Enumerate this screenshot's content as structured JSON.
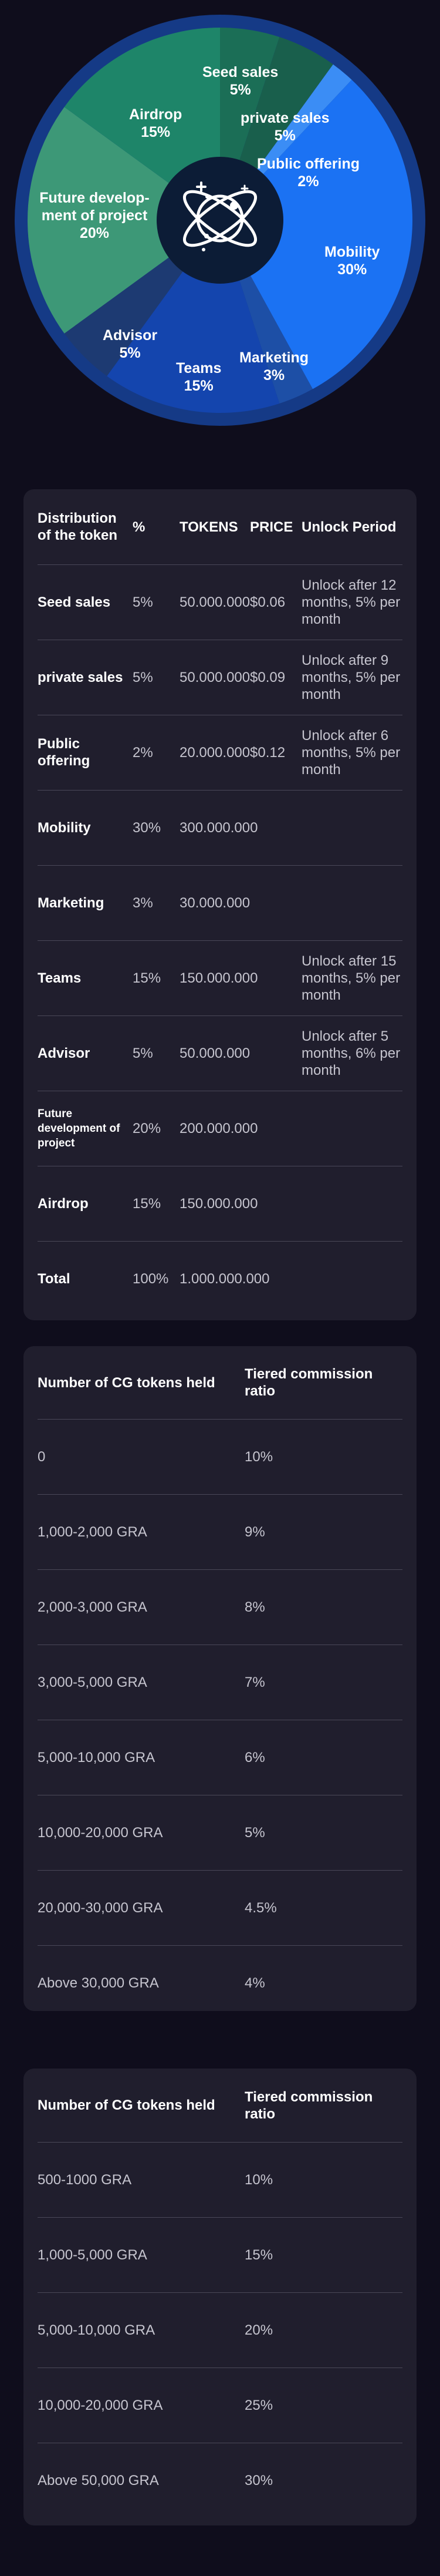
{
  "pie": {
    "slices": [
      {
        "name": "Seed sales",
        "pct": "5%",
        "value": 5,
        "color": "#1b6e56"
      },
      {
        "name": "private sales",
        "pct": "5%",
        "value": 5,
        "color": "#195f4c"
      },
      {
        "name": "Public offering",
        "pct": "2%",
        "value": 2,
        "color": "#3b8df5"
      },
      {
        "name": "Mobility",
        "pct": "30%",
        "value": 30,
        "color": "#1b72f3"
      },
      {
        "name": "Marketing",
        "pct": "3%",
        "value": 3,
        "color": "#1d4fa6"
      },
      {
        "name": "Teams",
        "pct": "15%",
        "value": 15,
        "color": "#1445ae"
      },
      {
        "name": "Advisor",
        "pct": "5%",
        "value": 5,
        "color": "#1d3a72"
      },
      {
        "name": "Future develop-ment of project",
        "pct": "20%",
        "value": 20,
        "color": "#3d9877"
      },
      {
        "name": "Airdrop",
        "pct": "15%",
        "value": 15,
        "color": "#1e8569"
      }
    ],
    "ring_color": "#153a86",
    "center_color": "#0c1c36"
  },
  "distribution": {
    "headers": {
      "name": "Distribution of the token",
      "pct": "%",
      "tokens": "TOKENS",
      "price": "PRICE",
      "unlock": "Unlock Period"
    },
    "rows": [
      {
        "name": "Seed sales",
        "pct": "5%",
        "tokens": "50.000.000",
        "price": "$0.06",
        "unlock": "Unlock after 12 months, 5% per month"
      },
      {
        "name": "private sales",
        "pct": "5%",
        "tokens": "50.000.000",
        "price": "$0.09",
        "unlock": "Unlock after 9 months, 5% per month"
      },
      {
        "name": "Public offering",
        "pct": "2%",
        "tokens": "20.000.000",
        "price": "$0.12",
        "unlock": "Unlock after 6 months, 5% per month"
      },
      {
        "name": "Mobility",
        "pct": "30%",
        "tokens": "300.000.000",
        "price": "",
        "unlock": ""
      },
      {
        "name": "Marketing",
        "pct": "3%",
        "tokens": "30.000.000",
        "price": "",
        "unlock": ""
      },
      {
        "name": "Teams",
        "pct": "15%",
        "tokens": "150.000.000",
        "price": "",
        "unlock": "Unlock after 15 months, 5% per month"
      },
      {
        "name": "Advisor",
        "pct": "5%",
        "tokens": "50.000.000",
        "price": "",
        "unlock": "Unlock after 5 months, 6% per month"
      },
      {
        "name": "Future development of project",
        "pct": "20%",
        "tokens": "200.000.000",
        "price": "",
        "unlock": ""
      },
      {
        "name": "Airdrop",
        "pct": "15%",
        "tokens": "150.000.000",
        "price": "",
        "unlock": ""
      },
      {
        "name": "Total",
        "pct": "100%",
        "tokens": "1.000.000.000",
        "price": "",
        "unlock": ""
      }
    ]
  },
  "commission_1": {
    "headers": {
      "held": "Number of CG tokens held",
      "ratio": "Tiered commission ratio"
    },
    "rows": [
      {
        "held": "0",
        "ratio": "10%"
      },
      {
        "held": "1,000-2,000 GRA",
        "ratio": "9%"
      },
      {
        "held": "2,000-3,000 GRA",
        "ratio": "8%"
      },
      {
        "held": "3,000-5,000 GRA",
        "ratio": "7%"
      },
      {
        "held": "5,000-10,000 GRA",
        "ratio": "6%"
      },
      {
        "held": "10,000-20,000 GRA",
        "ratio": "5%"
      },
      {
        "held": "20,000-30,000 GRA",
        "ratio": "4.5%"
      },
      {
        "held": "Above 30,000 GRA",
        "ratio": "4%"
      }
    ]
  },
  "commission_2": {
    "headers": {
      "held": "Number of CG tokens held",
      "ratio": "Tiered commission ratio"
    },
    "rows": [
      {
        "held": "500-1000 GRA",
        "ratio": "10%"
      },
      {
        "held": "1,000-5,000 GRA",
        "ratio": "15%"
      },
      {
        "held": "5,000-10,000 GRA",
        "ratio": "20%"
      },
      {
        "held": "10,000-20,000 GRA",
        "ratio": "25%"
      },
      {
        "held": "Above 50,000 GRA",
        "ratio": "30%"
      }
    ]
  }
}
